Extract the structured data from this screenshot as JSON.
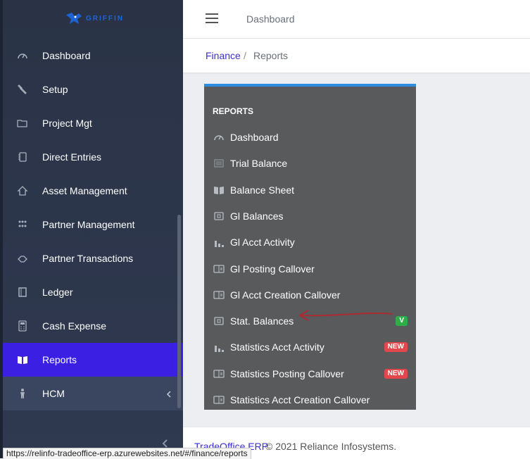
{
  "app": {
    "logo_text": "GRIFFIN"
  },
  "sidebar": {
    "items": [
      {
        "label": "Dashboard",
        "icon": "gauge-icon"
      },
      {
        "label": "Setup",
        "icon": "wrench-icon"
      },
      {
        "label": "Project Mgt",
        "icon": "folder-icon"
      },
      {
        "label": "Direct Entries",
        "icon": "notebook-icon"
      },
      {
        "label": "Asset Management",
        "icon": "house-icon"
      },
      {
        "label": "Partner Management",
        "icon": "people-grid-icon"
      },
      {
        "label": "Partner Transactions",
        "icon": "handshake-icon"
      },
      {
        "label": "Ledger",
        "icon": "ledger-book-icon"
      },
      {
        "label": "Cash Expense",
        "icon": "calculator-icon"
      },
      {
        "label": "Reports",
        "icon": "open-book-icon",
        "active": true
      },
      {
        "label": "HCM",
        "icon": "person-icon",
        "expandable": true
      }
    ]
  },
  "header": {
    "title": "Dashboard"
  },
  "breadcrumb": {
    "parent": "Finance",
    "separator": "/",
    "current": "Reports"
  },
  "reports": {
    "heading": "REPORTS",
    "items": [
      {
        "label": "Dashboard",
        "icon": "gauge-icon"
      },
      {
        "label": "Trial Balance",
        "icon": "list-icon"
      },
      {
        "label": "Balance Sheet",
        "icon": "book-icon"
      },
      {
        "label": "Gl Balances",
        "icon": "wallet-icon"
      },
      {
        "label": "Gl Acct Activity",
        "icon": "bar-chart-icon"
      },
      {
        "label": "Gl Posting Callover",
        "icon": "card-icon"
      },
      {
        "label": "Gl Acct Creation Callover",
        "icon": "card-icon"
      },
      {
        "label": "Stat. Balances",
        "icon": "wallet-icon",
        "badge": "V"
      },
      {
        "label": "Statistics Acct Activity",
        "icon": "bar-chart-icon",
        "badge": "NEW"
      },
      {
        "label": "Statistics Posting Callover",
        "icon": "card-icon",
        "badge": "NEW"
      },
      {
        "label": "Statistics Acct Creation Callover",
        "icon": "card-icon"
      }
    ]
  },
  "footer": {
    "link": "TradeOffice ERP",
    "text": "© 2021 Reliance Infosystems."
  },
  "status_url": "https://relinfo-tradeoffice-erp.azurewebsites.net/#/finance/reports",
  "colors": {
    "sidebar": "#2f3950",
    "active": "#3b1fe2",
    "panel": "#585a5c",
    "panel_accent": "#2d8de0",
    "badge_green": "#2eae47",
    "badge_red": "#e2474c",
    "arrow": "#b3282d"
  }
}
